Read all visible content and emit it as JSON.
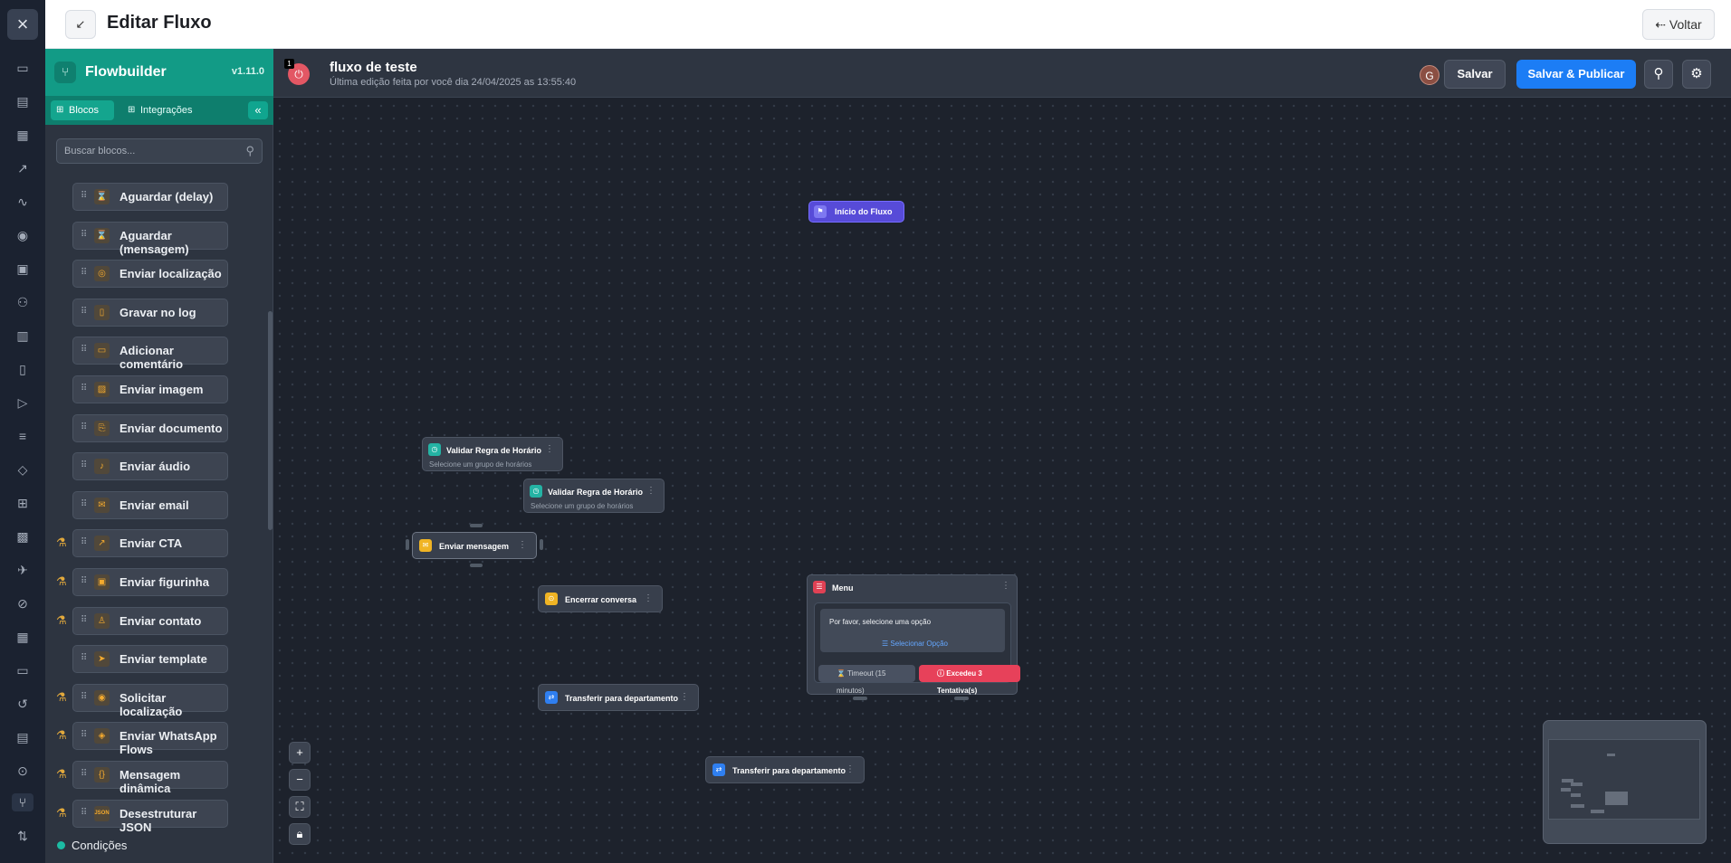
{
  "page": {
    "title": "Editar Fluxo",
    "back_label": "Voltar"
  },
  "rail": {
    "icons": [
      "close-icon",
      "chat-bubbles-icon",
      "messages-icon",
      "dashboard-icon",
      "chart-icon",
      "activity-icon",
      "eye-icon",
      "briefcase-icon",
      "users-icon",
      "building-icon",
      "contacts-icon",
      "send-icon",
      "list-icon",
      "tag-icon",
      "grid-icon",
      "contact-card-icon",
      "plane-icon",
      "ban-icon",
      "apps-icon",
      "id-card-icon",
      "history-icon",
      "calendar-icon",
      "broadcast-icon",
      "flow-icon",
      "swap-icon"
    ]
  },
  "sidebar": {
    "app_name": "Flowbuilder",
    "version": "v1.11.0",
    "tabs": [
      "Blocos",
      "Integrações"
    ],
    "search_placeholder": "Buscar blocos...",
    "blocks": [
      {
        "label": "Aguardar (delay)",
        "icon": "hourglass-icon",
        "beta": false
      },
      {
        "label": "Aguardar (mensagem)",
        "icon": "hourglass-icon",
        "beta": false
      },
      {
        "label": "Enviar localização",
        "icon": "location-icon",
        "beta": false
      },
      {
        "label": "Gravar no log",
        "icon": "book-icon",
        "beta": false
      },
      {
        "label": "Adicionar comentário",
        "icon": "comment-icon",
        "beta": false
      },
      {
        "label": "Enviar imagem",
        "icon": "image-icon",
        "beta": false
      },
      {
        "label": "Enviar documento",
        "icon": "paperclip-icon",
        "beta": false
      },
      {
        "label": "Enviar áudio",
        "icon": "microphone-icon",
        "beta": false
      },
      {
        "label": "Enviar email",
        "icon": "mail-icon",
        "beta": false
      },
      {
        "label": "Enviar CTA",
        "icon": "external-link-icon",
        "beta": true
      },
      {
        "label": "Enviar figurinha",
        "icon": "sticker-icon",
        "beta": true
      },
      {
        "label": "Enviar contato",
        "icon": "user-icon",
        "beta": true
      },
      {
        "label": "Enviar template",
        "icon": "send-icon",
        "beta": false
      },
      {
        "label": "Solicitar localização",
        "icon": "target-icon",
        "beta": true
      },
      {
        "label": "Enviar WhatsApp Flows",
        "icon": "layers-icon",
        "beta": true
      },
      {
        "label": "Mensagem dinâmica",
        "icon": "braces-icon",
        "beta": true
      },
      {
        "label": "Desestruturar JSON",
        "icon": "json-icon",
        "icon_text": "JSON",
        "beta": true
      }
    ],
    "section_label": "Condições"
  },
  "flow": {
    "name": "fluxo de teste",
    "subtitle": "Última edição feita por você dia 24/04/2025 as 13:55:40",
    "badge_count": "1",
    "avatar_initial": "G",
    "save_label": "Salvar",
    "publish_label": "Salvar & Publicar"
  },
  "nodes": {
    "start": "Início do Fluxo",
    "validar_title": "Validar Regra de Horário",
    "validar_subtitle": "Selecione um grupo de horários",
    "enviar_mensagem": "Enviar mensagem",
    "encerrar": "Encerrar conversa",
    "transferir": "Transferir para departamento",
    "menu": {
      "title": "Menu",
      "prompt": "Por favor, selecione uma opção",
      "select_option": "Selecionar Opção",
      "timeout": "Timeout (15 minutos)",
      "exceeded": "Excedeu 3 Tentativa(s)"
    }
  },
  "colors": {
    "accent": "#129b86",
    "primary": "#1c7df5",
    "start_node": "#574bd8",
    "danger": "#e7415a",
    "canvas": "#1d222c"
  }
}
